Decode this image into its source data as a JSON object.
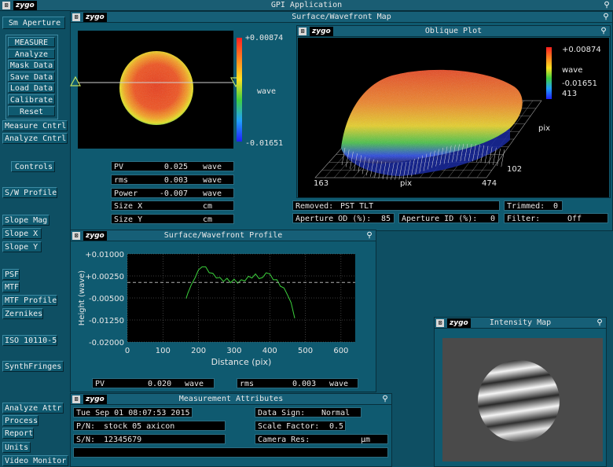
{
  "app": {
    "title": "GPI Application",
    "logo": "zygo"
  },
  "sidebar": {
    "aperture_label": "Sm Aperture",
    "main_buttons": [
      "MEASURE",
      "Analyze",
      "Mask Data",
      "Save Data",
      "Load Data",
      "Calibrate",
      "Reset"
    ],
    "items": [
      "Measure Cntrl",
      "Analyze Cntrl",
      "Controls",
      "S/W Profile",
      "Slope Mag",
      "Slope X",
      "Slope Y",
      "PSF",
      "MTF",
      "MTF Profile",
      "Zernikes",
      "ISO 10110-5",
      "SynthFringes",
      "Analyze Attr",
      "Process",
      "Report",
      "Units",
      "Video Monitor"
    ]
  },
  "surface_map": {
    "title": "Surface/Wavefront Map",
    "scale_max": "+0.00874",
    "scale_min": "-0.01651",
    "scale_unit": "wave",
    "stats": [
      {
        "label": "PV",
        "value": "0.025",
        "unit": "wave"
      },
      {
        "label": "rms",
        "value": "0.003",
        "unit": "wave"
      },
      {
        "label": "Power",
        "value": "-0.007",
        "unit": "wave"
      },
      {
        "label": "Size X",
        "value": "",
        "unit": "cm"
      },
      {
        "label": "Size Y",
        "value": "",
        "unit": "cm"
      }
    ]
  },
  "oblique_plot": {
    "title": "Oblique Plot",
    "scale_max": "+0.00874",
    "scale_unit": "wave",
    "scale_min": "-0.01651",
    "z_extra": "413",
    "y_axis_unit": "pix",
    "y_axis_low": "102",
    "x_axis_left": "163",
    "x_axis_unit": "pix",
    "x_axis_right": "474",
    "removed_label": "Removed:",
    "removed_value": "PST TLT",
    "trimmed_label": "Trimmed:",
    "trimmed_value": "0",
    "aperture_od_label": "Aperture OD (%):",
    "aperture_od_value": "85",
    "aperture_id_label": "Aperture ID (%):",
    "aperture_id_value": "0",
    "filter_label": "Filter:",
    "filter_value": "Off"
  },
  "profile": {
    "title": "Surface/Wavefront Profile",
    "pv_label": "PV",
    "pv_value": "0.020",
    "pv_unit": "wave",
    "rms_label": "rms",
    "rms_value": "0.003",
    "rms_unit": "wave"
  },
  "chart_data": {
    "type": "line",
    "xlabel": "Distance (pix)",
    "ylabel": "Height (wave)",
    "xlim": [
      0,
      640
    ],
    "ylim": [
      -0.02,
      0.01
    ],
    "x_ticks": [
      "0",
      "100",
      "200",
      "300",
      "400",
      "500",
      "600"
    ],
    "y_ticks": [
      "+0.01000",
      "+0.00250",
      "-0.00500",
      "-0.01250",
      "-0.02000"
    ],
    "dashed_reference_y": 0.0003,
    "series": [
      {
        "x": [
          165,
          170,
          180,
          190,
          200,
          210,
          220,
          230,
          240,
          250,
          260,
          270,
          280,
          290,
          300,
          310,
          320,
          330,
          340,
          350,
          360,
          370,
          380,
          390,
          400,
          410,
          420,
          430,
          440,
          450,
          460,
          470
        ],
        "y": [
          -0.0056,
          -0.003,
          -0.0008,
          0.0022,
          0.0042,
          0.006,
          0.0052,
          0.004,
          0.003,
          0.0022,
          0.0016,
          0.001,
          0.0013,
          0.0006,
          0.001,
          0.0004,
          0.0008,
          0.0012,
          0.002,
          0.0022,
          0.0028,
          0.002,
          0.0016,
          0.004,
          0.0028,
          0.0016,
          0.0008,
          -0.0006,
          -0.002,
          -0.0036,
          -0.007,
          -0.0115
        ]
      }
    ]
  },
  "attributes": {
    "title": "Measurement Attributes",
    "date": "Tue Sep 01 08:07:53 2015",
    "pn_label": "P/N:",
    "pn_value": "stock 05 axicon",
    "sn_label": "S/N:",
    "sn_value": "12345679",
    "data_sign_label": "Data Sign:",
    "data_sign_value": "Normal",
    "scale_factor_label": "Scale Factor:",
    "scale_factor_value": "0.5",
    "camera_res_label": "Camera Res:",
    "camera_res_value": "",
    "camera_res_unit": "µm"
  },
  "intensity": {
    "title": "Intensity Map"
  },
  "colors": {
    "background": "#0e4f63",
    "panel": "#0f5a70",
    "trace": "#3cd23c",
    "grid": "#7a7a7a"
  }
}
